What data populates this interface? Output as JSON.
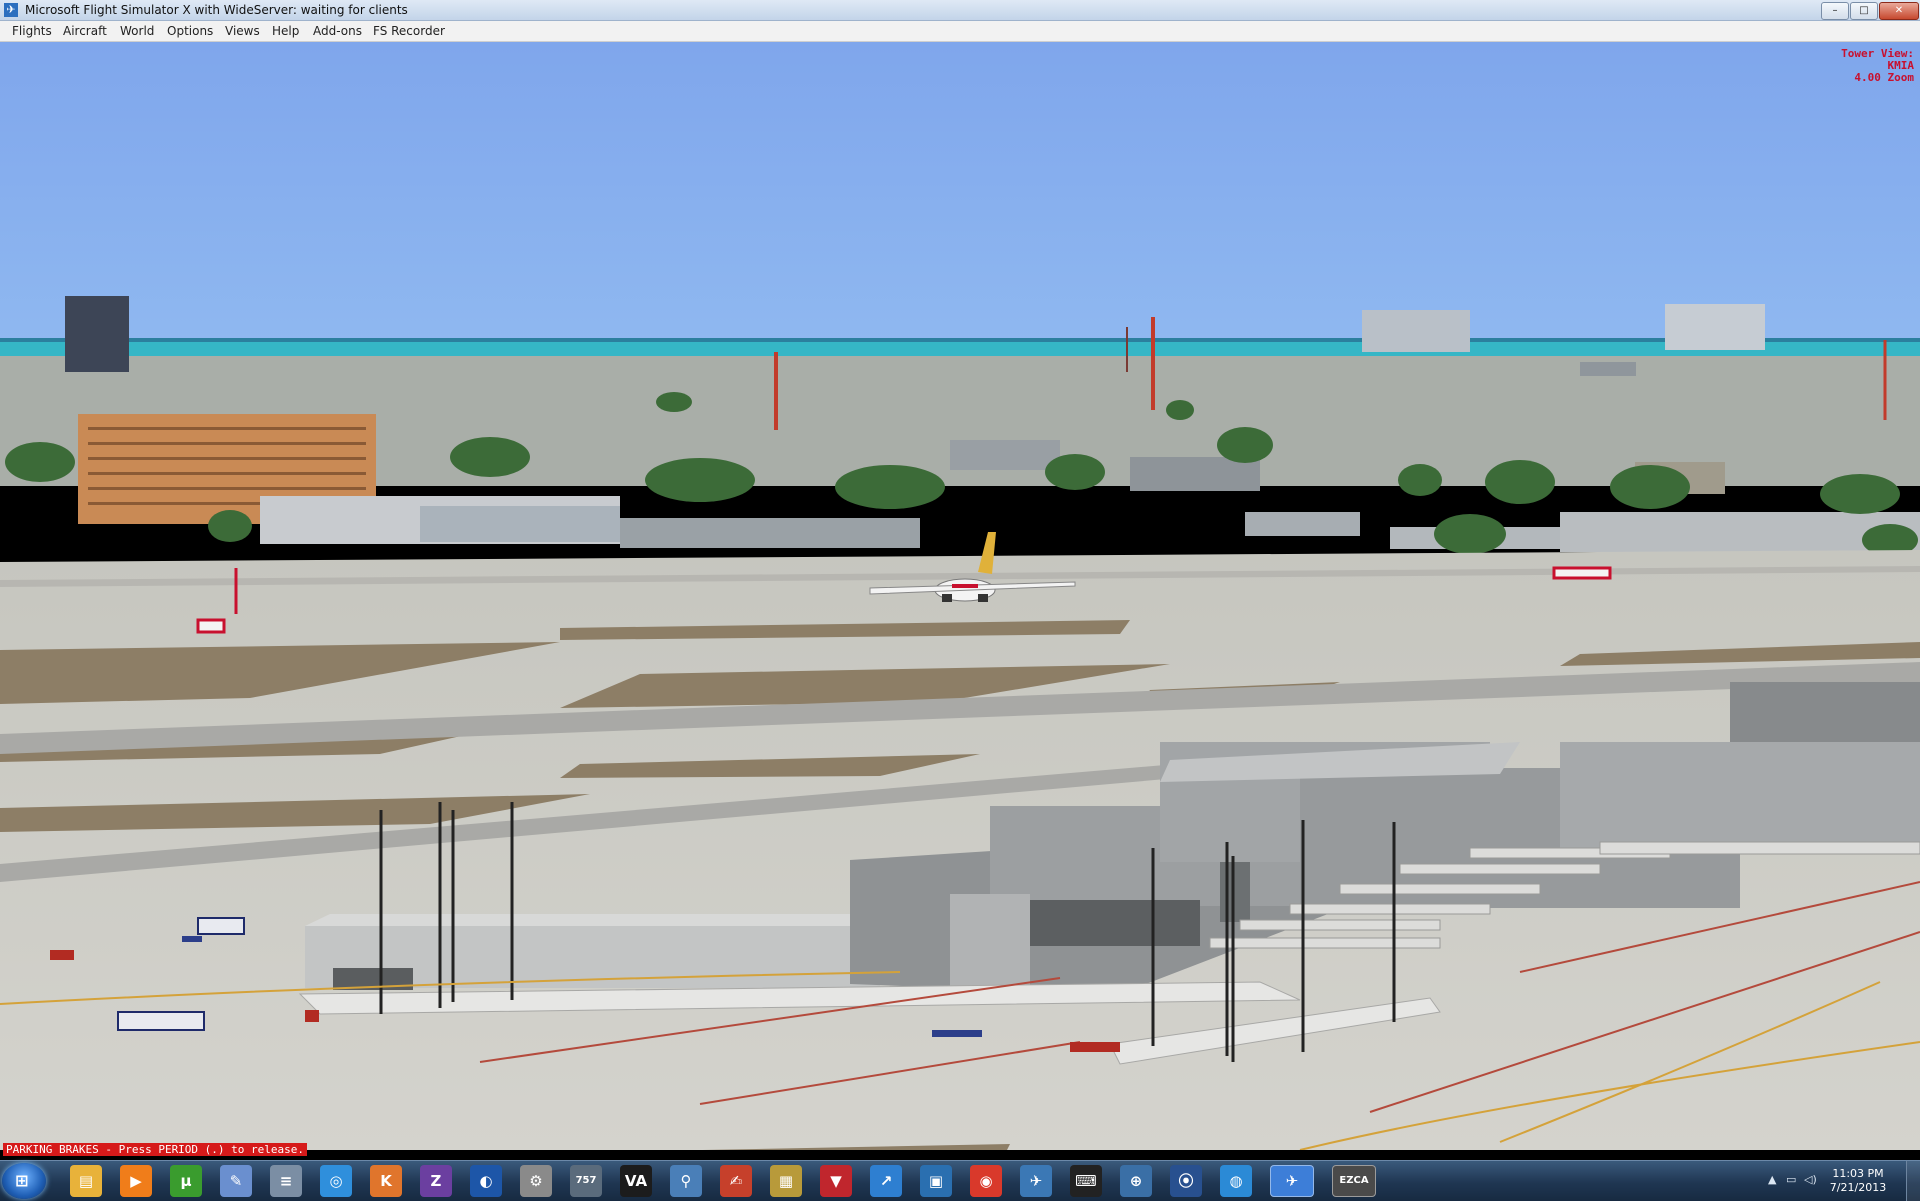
{
  "window": {
    "title": "Microsoft Flight Simulator X with WideServer: waiting for clients",
    "min_label": "–",
    "max_label": "□",
    "close_label": "✕"
  },
  "menu": [
    "Flights",
    "Aircraft",
    "World",
    "Options",
    "Views",
    "Help",
    "Add-ons",
    "FS Recorder"
  ],
  "view_info": {
    "line1": "Tower View:",
    "line2": "KMIA",
    "line3": "4.00 Zoom"
  },
  "status": {
    "parking_brakes": "PARKING BRAKES - Press PERIOD (.) to release."
  },
  "taskbar": {
    "apps": [
      {
        "name": "windows-explorer-icon",
        "glyph": "▤",
        "color": "#e8b23a"
      },
      {
        "name": "media-player-icon",
        "glyph": "▶",
        "color": "#f07d1a"
      },
      {
        "name": "utorrent-icon",
        "glyph": "μ",
        "color": "#3a9c2e"
      },
      {
        "name": "paint-icon",
        "glyph": "✎",
        "color": "#6a8fcf"
      },
      {
        "name": "calculator-icon",
        "glyph": "≡",
        "color": "#7b8ea4"
      },
      {
        "name": "disc-burner-icon",
        "glyph": "◎",
        "color": "#2f8fdc"
      },
      {
        "name": "kmplayer-icon",
        "glyph": "K",
        "color": "#e0752c"
      },
      {
        "name": "cpuz-icon",
        "glyph": "Z",
        "color": "#6b3fa0"
      },
      {
        "name": "google-earth-icon",
        "glyph": "◐",
        "color": "#1d56a8"
      },
      {
        "name": "film-reel-icon",
        "glyph": "⚙",
        "color": "#8a8a8a"
      },
      {
        "name": "boeing-757-icon",
        "glyph": "757",
        "color": "#5a6b7c"
      },
      {
        "name": "virtual-airline-icon",
        "glyph": "VA",
        "color": "#1c1c1c"
      },
      {
        "name": "search-tool-icon",
        "glyph": "⚲",
        "color": "#4a7fb8"
      },
      {
        "name": "notepad-icon",
        "glyph": "✍",
        "color": "#c6402b"
      },
      {
        "name": "archive-icon",
        "glyph": "▦",
        "color": "#b89a3a"
      },
      {
        "name": "downloader-icon",
        "glyph": "▼",
        "color": "#c0262d"
      },
      {
        "name": "chart-tool-icon",
        "glyph": "↗",
        "color": "#2e7fd1"
      },
      {
        "name": "cpu-monitor-icon",
        "glyph": "▣",
        "color": "#2a6fb0"
      },
      {
        "name": "chrome-icon",
        "glyph": "◉",
        "color": "#d9392b"
      },
      {
        "name": "flight-planner-icon",
        "glyph": "✈",
        "color": "#3b78b5"
      },
      {
        "name": "keyboard-key-icon",
        "glyph": "⌨",
        "color": "#222222"
      },
      {
        "name": "globe-network-icon",
        "glyph": "⊕",
        "color": "#3a6fa6"
      },
      {
        "name": "steam-icon",
        "glyph": "⦿",
        "color": "#28508f"
      },
      {
        "name": "disc-tool-icon",
        "glyph": "◍",
        "color": "#2b8ad6"
      },
      {
        "name": "fsx-icon",
        "glyph": "✈",
        "color": "#3d7ed8"
      },
      {
        "name": "ezca-icon",
        "glyph": "EZCA",
        "color": "#4a4a4a"
      }
    ],
    "tray": {
      "time": "11:03 PM",
      "date": "7/21/2013",
      "arrow": "▲"
    }
  },
  "colors": {
    "sky": "#86acee",
    "sea": "#35b6c6",
    "tarmac": "#c9c9c4",
    "grass": "#8a7a64",
    "terminal": "#8f9294",
    "parking_red": "#d61a1a",
    "readout_red": "#c8102e"
  }
}
